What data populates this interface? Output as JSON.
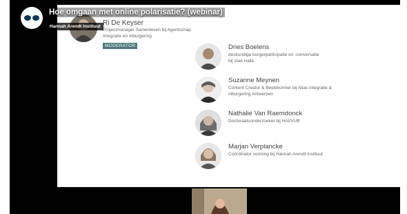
{
  "video": {
    "title": "Hoe omgaan met online polarisatie? (webinar)",
    "channel": "Hannah Arendt Instituut",
    "logo_icon": "eye-logo-icon"
  },
  "moderator": {
    "name": "Ri De Keyser",
    "role_line1": "Projectmanager Samenleven bij Agentschap",
    "role_line2": "Integratie en Inburgering",
    "badge": "MODERATOR"
  },
  "speakers": [
    {
      "name": "Dries Boelens",
      "role_line1": "deskundige burgerparticipatie en -conversatie",
      "role_line2": "bij stad Halle"
    },
    {
      "name": "Suzanne Meynen",
      "role_line1": "Content Creator & Beeldvormer bij Atlas integratie &",
      "role_line2": "inburgering Antwerpen"
    },
    {
      "name": "Nathalie Van Raemdonck",
      "role_line1": "Doctoraatsonderzoeker bij HAI/VUB",
      "role_line2": ""
    },
    {
      "name": "Marjan Verplancke",
      "role_line1": "Coördinator vorming bij Hannah Arendt Instituut",
      "role_line2": ""
    }
  ],
  "colors": {
    "video_background": "#000000",
    "slide_background": "#ffffff",
    "badge_background": "#4a7a78"
  }
}
